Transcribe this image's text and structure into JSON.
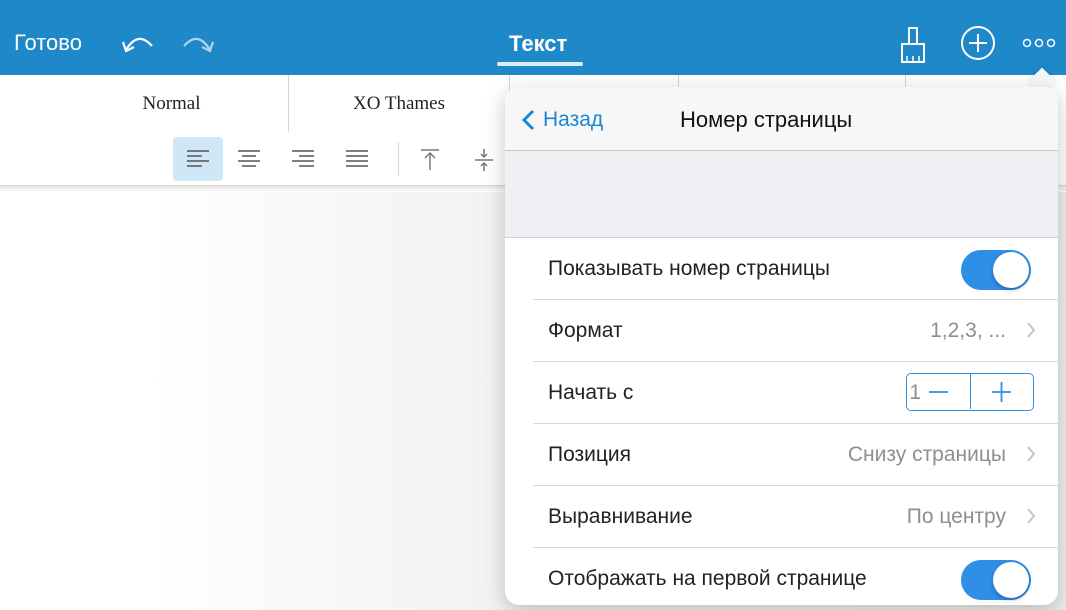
{
  "toolbar": {
    "done_label": "Готово",
    "tab_label": "Текст",
    "icons": [
      "undo-icon",
      "redo-icon",
      "paint-brush-icon",
      "add-icon",
      "more-icon"
    ]
  },
  "styles": [
    "Normal",
    "XO Thames"
  ],
  "popover": {
    "back_label": "Назад",
    "title": "Номер страницы",
    "rows": [
      {
        "label": "Показывать номер страницы",
        "type": "toggle",
        "on": true
      },
      {
        "label": "Формат",
        "value": "1,2,3, ..."
      },
      {
        "label": "Начать с",
        "value": "1",
        "type": "stepper"
      },
      {
        "label": "Позиция",
        "value": "Снизу страницы"
      },
      {
        "label": "Выравнивание",
        "value": "По центру"
      },
      {
        "label": "Отображать на первой странице",
        "type": "toggle",
        "on": true
      }
    ]
  },
  "colors": {
    "toolbar_bg": "#1e88c8",
    "accent": "#2f8ee6",
    "link": "#1a87d6"
  }
}
